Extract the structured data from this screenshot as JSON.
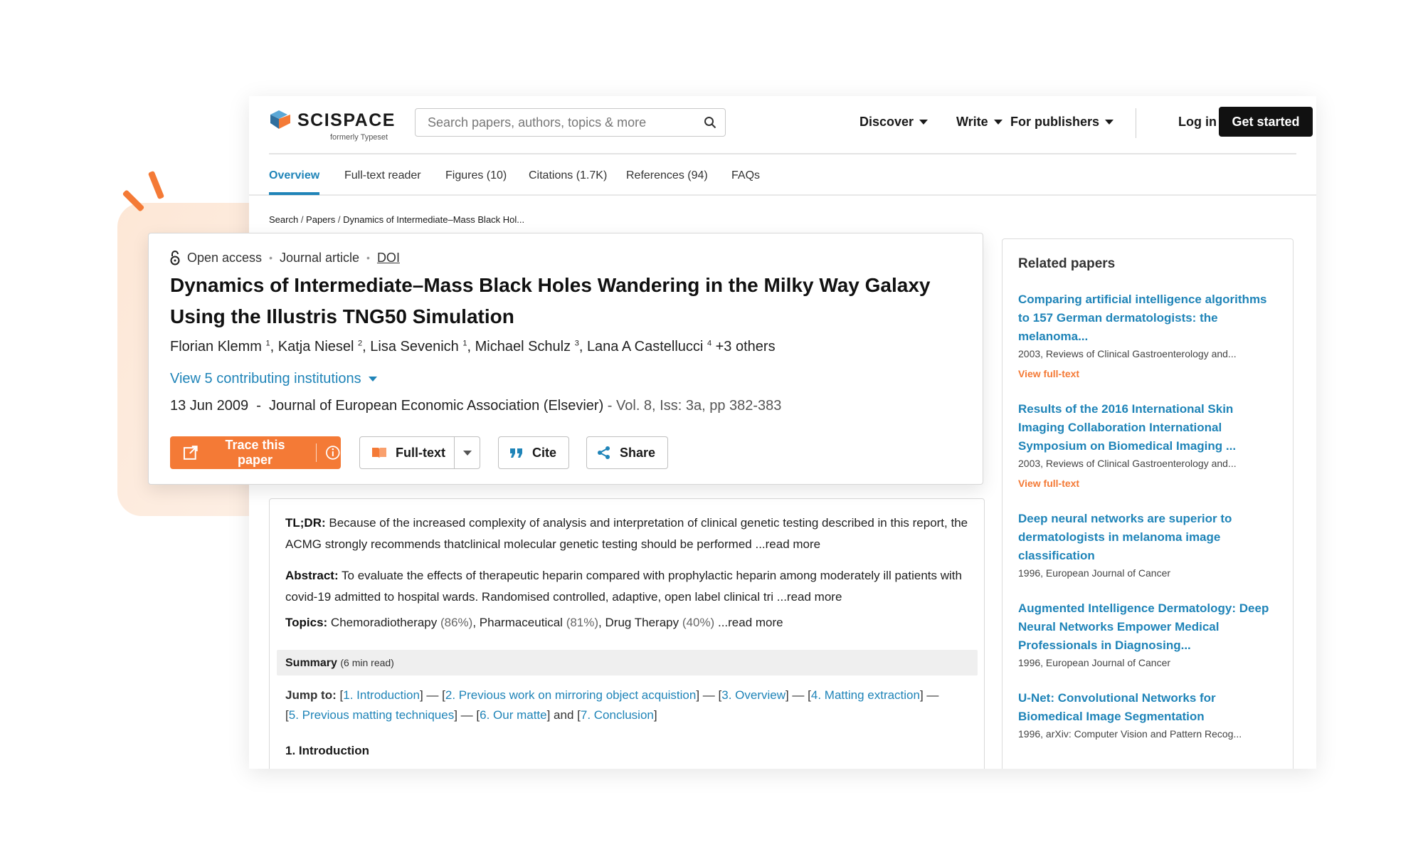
{
  "brand": {
    "name": "SCISPACE",
    "tagline": "formerly Typeset"
  },
  "search": {
    "placeholder": "Search papers, authors, topics & more"
  },
  "nav": {
    "discover": "Discover",
    "write": "Write",
    "publishers": "For publishers",
    "login": "Log in",
    "get_started": "Get started"
  },
  "tabs": [
    "Overview",
    "Full-text reader",
    "Figures (10)",
    "Citations (1.7K)",
    "References (94)",
    "FAQs"
  ],
  "breadcrumb": {
    "search": "Search",
    "papers": "Papers",
    "current": "Dynamics of Intermediate–Mass Black Hol..."
  },
  "paper": {
    "access": "Open access",
    "type": "Journal article",
    "doi": "DOI",
    "title": "Dynamics of Intermediate–Mass Black Holes Wandering in the Milky Way Galaxy Using the Illustris TNG50 Simulation",
    "authors": [
      {
        "name": "Florian Klemm",
        "aff": "1"
      },
      {
        "name": "Katja Niesel",
        "aff": "2"
      },
      {
        "name": "Lisa Sevenich",
        "aff": "1"
      },
      {
        "name": "Michael Schulz",
        "aff": "3"
      },
      {
        "name": "Lana A Castellucci",
        "aff": "4"
      }
    ],
    "others": "+3 others",
    "institutions": "View 5 contributing institutions",
    "date": "13 Jun 2009",
    "journal": "Journal of European Economic Association (Elsevier)",
    "volume": "- Vol. 8, Iss: 3a, pp 382-383"
  },
  "actions": {
    "trace": "Trace this paper",
    "fulltext": "Full-text",
    "cite": "Cite",
    "share": "Share"
  },
  "content": {
    "tldr_label": "TL;DR:",
    "tldr": "Because of the increased complexity of analysis and interpretation of clinical genetic testing described in this report, the ACMG strongly recommends thatclinical molecular genetic testing should be performed ...read more",
    "abstract_label": "Abstract:",
    "abstract": "To evaluate the effects of therapeutic heparin compared with prophylactic heparin among moderately ill patients with covid-19 admitted to hospital wards. Randomised controlled, adaptive, open label clinical tri ...read more",
    "topics_label": "Topics:",
    "topics": [
      {
        "name": "Chemoradiotherapy",
        "pct": "(86%)"
      },
      {
        "name": "Pharmaceutical",
        "pct": "(81%)"
      },
      {
        "name": "Drug Therapy",
        "pct": "(40%)"
      }
    ],
    "topics_more": "...read more",
    "summary_label": "Summary",
    "summary_time": "(6 min read)",
    "jump_label": "Jump to:",
    "jump_links": [
      "1. Introduction",
      "2. Previous work on mirroring object acquistion",
      "3. Overview",
      "4. Matting extraction",
      "5. Previous matting techniques",
      "6. Our matte",
      "7. Conclusion"
    ],
    "intro_heading": "1. Introduction"
  },
  "related": {
    "heading": "Related papers",
    "items": [
      {
        "title": "Comparing artificial intelligence algorithms to 157 German dermatologists: the melanoma...",
        "meta": "2003, Reviews of Clinical Gastroenterology and...",
        "link": "View full-text"
      },
      {
        "title": "Results of the 2016 International Skin Imaging Collaboration International Symposium on Biomedical Imaging ...",
        "meta": "2003, Reviews of Clinical Gastroenterology and...",
        "link": "View full-text"
      },
      {
        "title": "Deep neural networks are superior to dermatologists in melanoma image classification",
        "meta": "1996, European Journal of Cancer",
        "link": ""
      },
      {
        "title": "Augmented Intelligence Dermatology: Deep Neural Networks Empower Medical Professionals in Diagnosing...",
        "meta": "1996, European Journal of Cancer",
        "link": ""
      },
      {
        "title": "U-Net: Convolutional Networks for Biomedical Image Segmentation",
        "meta": "1996, arXiv: Computer Vision and Pattern Recog...",
        "link": ""
      }
    ]
  },
  "colors": {
    "accent": "#1f84b8",
    "orange": "#f47a36",
    "dark": "#111111"
  }
}
